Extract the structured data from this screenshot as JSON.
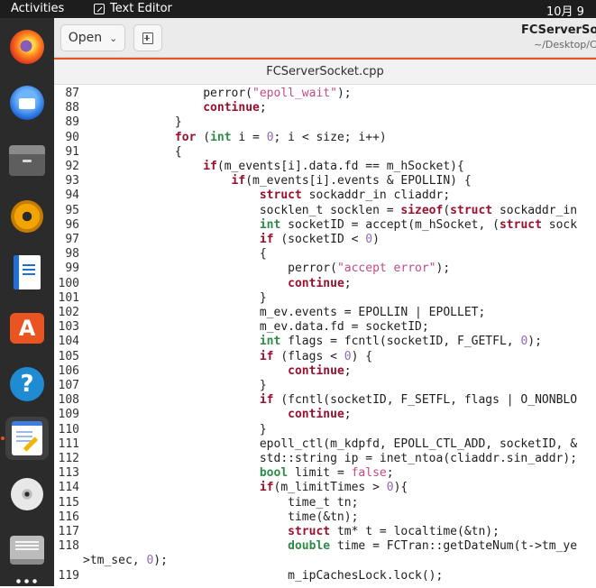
{
  "topbar": {
    "activities": "Activities",
    "app_name": "Text Editor",
    "clock": "10月 9"
  },
  "dock": {
    "items": [
      {
        "name": "firefox"
      },
      {
        "name": "thunderbird"
      },
      {
        "name": "files"
      },
      {
        "name": "rhythmbox"
      },
      {
        "name": "libreoffice-writer"
      },
      {
        "name": "ubuntu-software"
      },
      {
        "name": "help"
      },
      {
        "name": "text-editor",
        "active": true
      },
      {
        "name": "disc"
      },
      {
        "name": "drive"
      }
    ]
  },
  "header": {
    "open_label": "Open",
    "window_title": "FCServerSoc",
    "window_subtitle": "~/Desktop/C"
  },
  "tabs": [
    {
      "label": "FCServerSocket.cpp",
      "active": true
    }
  ],
  "accent_color": "#e95420",
  "syntax_colors": {
    "keyword": "#9b0f2e",
    "type": "#2f8a4a",
    "string": "#c24b86",
    "number": "#8f6ab8"
  },
  "editor": {
    "lines": [
      {
        "num": "87",
        "tokens": [
          [
            "",
            "                perror("
          ],
          [
            "st",
            "\"epoll_wait\""
          ],
          [
            "",
            ");"
          ]
        ]
      },
      {
        "num": "88",
        "tokens": [
          [
            "",
            "                "
          ],
          [
            "kw",
            "continue"
          ],
          [
            "",
            ";"
          ]
        ]
      },
      {
        "num": "89",
        "tokens": [
          [
            "",
            "            }"
          ]
        ]
      },
      {
        "num": "90",
        "tokens": [
          [
            "",
            "            "
          ],
          [
            "kw",
            "for"
          ],
          [
            "",
            " ("
          ],
          [
            "ty",
            "int"
          ],
          [
            "",
            " i = "
          ],
          [
            "nm",
            "0"
          ],
          [
            "",
            "; i < size; i++)"
          ]
        ]
      },
      {
        "num": "91",
        "tokens": [
          [
            "",
            "            {"
          ]
        ]
      },
      {
        "num": "92",
        "tokens": [
          [
            "",
            "                "
          ],
          [
            "kw",
            "if"
          ],
          [
            "",
            "(m_events[i].data.fd == m_hSocket){"
          ]
        ]
      },
      {
        "num": "93",
        "tokens": [
          [
            "",
            "                    "
          ],
          [
            "kw",
            "if"
          ],
          [
            "",
            "(m_events[i].events & EPOLLIN) {"
          ]
        ]
      },
      {
        "num": "94",
        "tokens": [
          [
            "",
            "                        "
          ],
          [
            "kw",
            "struct"
          ],
          [
            "",
            " sockaddr_in cliaddr;"
          ]
        ]
      },
      {
        "num": "95",
        "tokens": [
          [
            "",
            "                        socklen_t socklen = "
          ],
          [
            "kw",
            "sizeof"
          ],
          [
            "",
            "("
          ],
          [
            "kw",
            "struct"
          ],
          [
            "",
            " sockaddr_in"
          ]
        ]
      },
      {
        "num": "96",
        "tokens": [
          [
            "",
            "                        "
          ],
          [
            "ty",
            "int"
          ],
          [
            "",
            " socketID = accept(m_hSocket, ("
          ],
          [
            "kw",
            "struct"
          ],
          [
            "",
            " sock"
          ]
        ]
      },
      {
        "num": "97",
        "tokens": [
          [
            "",
            "                        "
          ],
          [
            "kw",
            "if"
          ],
          [
            "",
            " (socketID < "
          ],
          [
            "nm",
            "0"
          ],
          [
            "",
            ")"
          ]
        ]
      },
      {
        "num": "98",
        "tokens": [
          [
            "",
            "                        {"
          ]
        ]
      },
      {
        "num": "99",
        "tokens": [
          [
            "",
            "                            perror("
          ],
          [
            "st",
            "\"accept error\""
          ],
          [
            "",
            ");"
          ]
        ]
      },
      {
        "num": "100",
        "tokens": [
          [
            "",
            "                            "
          ],
          [
            "kw",
            "continue"
          ],
          [
            "",
            ";"
          ]
        ]
      },
      {
        "num": "101",
        "tokens": [
          [
            "",
            "                        }"
          ]
        ]
      },
      {
        "num": "102",
        "tokens": [
          [
            "",
            "                        m_ev.events = EPOLLIN | EPOLLET;"
          ]
        ]
      },
      {
        "num": "103",
        "tokens": [
          [
            "",
            "                        m_ev.data.fd = socketID;"
          ]
        ]
      },
      {
        "num": "104",
        "tokens": [
          [
            "",
            "                        "
          ],
          [
            "ty",
            "int"
          ],
          [
            "",
            " flags = fcntl(socketID, F_GETFL, "
          ],
          [
            "nm",
            "0"
          ],
          [
            "",
            ");"
          ]
        ]
      },
      {
        "num": "105",
        "tokens": [
          [
            "",
            "                        "
          ],
          [
            "kw",
            "if"
          ],
          [
            "",
            " (flags < "
          ],
          [
            "nm",
            "0"
          ],
          [
            "",
            ") {"
          ]
        ]
      },
      {
        "num": "106",
        "tokens": [
          [
            "",
            "                            "
          ],
          [
            "kw",
            "continue"
          ],
          [
            "",
            ";"
          ]
        ]
      },
      {
        "num": "107",
        "tokens": [
          [
            "",
            "                        }"
          ]
        ]
      },
      {
        "num": "108",
        "tokens": [
          [
            "",
            "                        "
          ],
          [
            "kw",
            "if"
          ],
          [
            "",
            " (fcntl(socketID, F_SETFL, flags | O_NONBLO"
          ]
        ]
      },
      {
        "num": "109",
        "tokens": [
          [
            "",
            "                            "
          ],
          [
            "kw",
            "continue"
          ],
          [
            "",
            ";"
          ]
        ]
      },
      {
        "num": "110",
        "tokens": [
          [
            "",
            "                        }"
          ]
        ]
      },
      {
        "num": "111",
        "tokens": [
          [
            "",
            "                        epoll_ctl(m_kdpfd, EPOLL_CTL_ADD, socketID, &"
          ]
        ]
      },
      {
        "num": "112",
        "tokens": [
          [
            "",
            "                        std::string ip = inet_ntoa(cliaddr.sin_addr);"
          ]
        ]
      },
      {
        "num": "113",
        "tokens": [
          [
            "",
            "                        "
          ],
          [
            "ty",
            "bool"
          ],
          [
            "",
            " limit = "
          ],
          [
            "st",
            "false"
          ],
          [
            "",
            ";"
          ]
        ]
      },
      {
        "num": "114",
        "tokens": [
          [
            "",
            "                        "
          ],
          [
            "kw",
            "if"
          ],
          [
            "",
            "(m_limitTimes > "
          ],
          [
            "nm",
            "0"
          ],
          [
            "",
            "){"
          ]
        ]
      },
      {
        "num": "115",
        "tokens": [
          [
            "",
            "                            time_t tn;"
          ]
        ]
      },
      {
        "num": "116",
        "tokens": [
          [
            "",
            "                            time(&tn);"
          ]
        ]
      },
      {
        "num": "117",
        "tokens": [
          [
            "",
            "                            "
          ],
          [
            "kw",
            "struct"
          ],
          [
            "",
            " tm* t = localtime(&tn);"
          ]
        ]
      },
      {
        "num": "118",
        "tokens": [
          [
            "",
            "                            "
          ],
          [
            "ty",
            "double"
          ],
          [
            "",
            " time = FCTran::getDateNum(t->tm_ye"
          ]
        ]
      },
      {
        "num": "",
        "wrap": true,
        "tokens": [
          [
            "",
            ">tm_sec, "
          ],
          [
            "nm",
            "0"
          ],
          [
            "",
            ");"
          ]
        ]
      },
      {
        "num": "119",
        "tokens": [
          [
            "",
            "                            m_ipCachesLock.lock();"
          ]
        ]
      }
    ]
  }
}
